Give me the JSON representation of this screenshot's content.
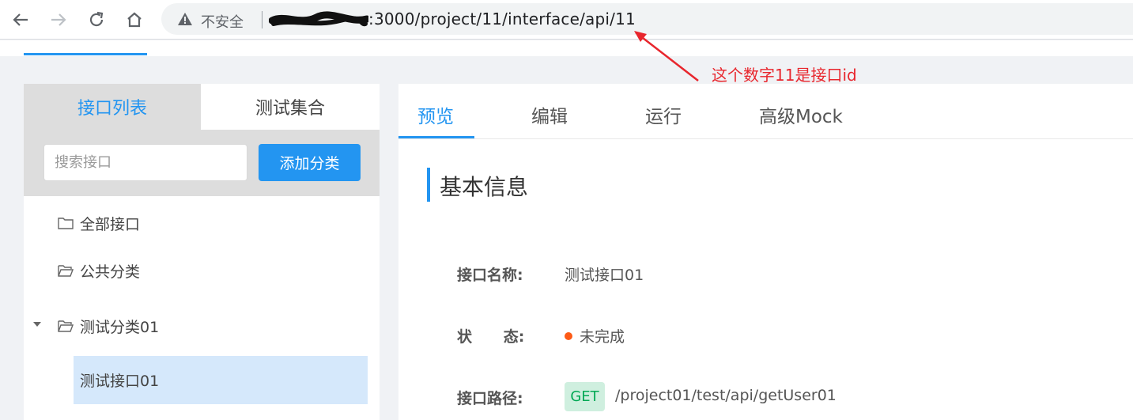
{
  "browser": {
    "insecure_label": "不安全",
    "url_visible": ":3000/project/11/interface/api/11"
  },
  "annotation": {
    "text": "这个数字11是接口id"
  },
  "left_panel": {
    "tabs": [
      {
        "label": "接口列表",
        "active": true
      },
      {
        "label": "测试集合",
        "active": false
      }
    ],
    "search": {
      "placeholder": "搜索接口",
      "value": ""
    },
    "add_category_label": "添加分类",
    "tree": {
      "all_label": "全部接口",
      "public_label": "公共分类",
      "category_label": "测试分类01",
      "category_expanded": true,
      "selected_item_label": "测试接口01"
    }
  },
  "right_panel": {
    "tabs": [
      {
        "label": "预览",
        "active": true
      },
      {
        "label": "编辑",
        "active": false
      },
      {
        "label": "运行",
        "active": false
      },
      {
        "label": "高级Mock",
        "active": false
      }
    ],
    "section_title": "基本信息",
    "fields": {
      "name_label": "接口名称:",
      "name_value": "测试接口01",
      "status_label": "状      态:",
      "status_value": "未完成",
      "path_label": "接口路径:",
      "method": "GET",
      "path_value": "/project01/test/api/getUser01"
    }
  },
  "colors": {
    "accent": "#2395f1",
    "annotation": "#e8262d",
    "status_incomplete": "#fd5a16",
    "get_badge_bg": "#cfefdf",
    "get_badge_text": "#00a854"
  }
}
